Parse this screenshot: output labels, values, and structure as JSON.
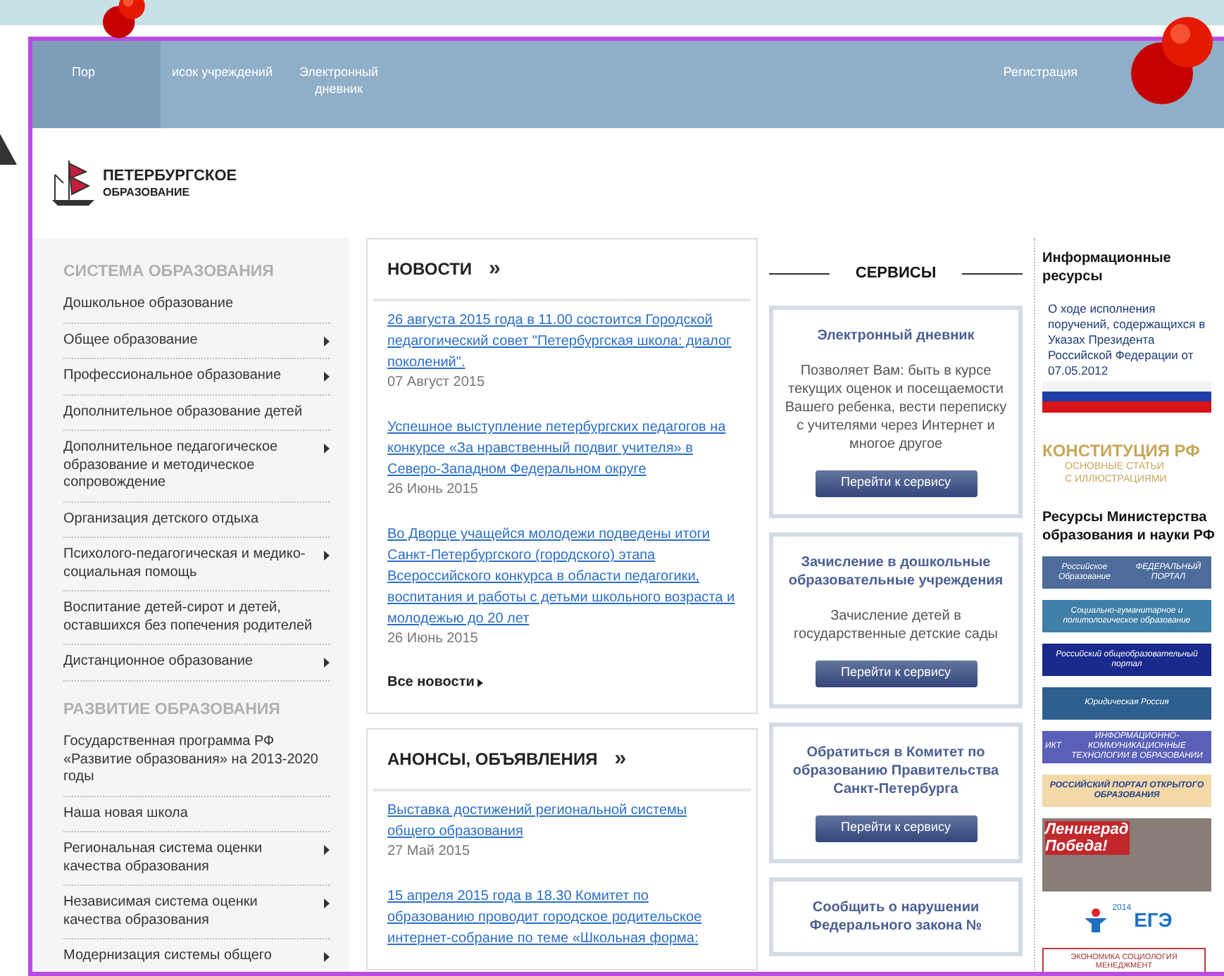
{
  "nav": {
    "items": [
      {
        "label": "Пор",
        "selected": true
      },
      {
        "label": "исок учреждений",
        "selected": false
      },
      {
        "label": "Электронный дневник",
        "selected": false
      }
    ],
    "register": "Регистрация"
  },
  "logo": {
    "line_1": "ПЕТЕРБУРГСКОЕ",
    "line_2": "ОБРАЗОВАНИЕ"
  },
  "sidebar": [
    {
      "title": "СИСТЕМА ОБРАЗОВАНИЯ",
      "items": [
        {
          "label": "Дошкольное образование",
          "has_submenu": false
        },
        {
          "label": "Общее образование",
          "has_submenu": true
        },
        {
          "label": "Профессиональное образование",
          "has_submenu": true
        },
        {
          "label": "Дополнительное образование детей",
          "has_submenu": false
        },
        {
          "label": "Дополнительное педагогическое образование и методическое сопровождение",
          "has_submenu": true
        },
        {
          "label": "Организация детского отдыха",
          "has_submenu": false
        },
        {
          "label": "Психолого-педагогическая и медико-социальная помощь",
          "has_submenu": true
        },
        {
          "label": "Воспитание детей-сирот и детей, оставшихся без попечения родителей",
          "has_submenu": false
        },
        {
          "label": "Дистанционное образование",
          "has_submenu": true
        }
      ]
    },
    {
      "title": "РАЗВИТИЕ ОБРАЗОВАНИЯ",
      "items": [
        {
          "label": "Государственная программа РФ «Развитие образования» на 2013-2020 годы",
          "has_submenu": false
        },
        {
          "label": "Наша новая школа",
          "has_submenu": false
        },
        {
          "label": "Региональная система оценки качества образования",
          "has_submenu": true
        },
        {
          "label": "Независимая система оценки качества образования",
          "has_submenu": true
        },
        {
          "label": "Модернизация системы общего",
          "has_submenu": true
        }
      ]
    }
  ],
  "news": [
    {
      "title": "НОВОСТИ",
      "arrow": "»",
      "items": [
        {
          "link": "26 августа 2015 года в 11.00 состоится Городской педагогический совет \"Петербургская школа: диалог поколений\".",
          "date": "07 Август 2015"
        },
        {
          "link": "Успешное выступление петербургских педагогов на конкурсе «За нравственный подвиг учителя» в Северо-Западном Федеральном округе",
          "date": "26 Июнь 2015"
        },
        {
          "link": "Во Дворце учащейся молодежи подведены итоги Санкт-Петербургского (городского) этапа Всероссийского конкурса в области педагогики, воспитания и работы с детьми школьного возраста и молодежью до 20 лет",
          "date": "26 Июнь 2015"
        }
      ],
      "more": "Все новости"
    },
    {
      "title": "АНОНСЫ, ОБЪЯВЛЕНИЯ",
      "arrow": "»",
      "items": [
        {
          "link": "Выставка достижений региональной системы общего образования",
          "date": "27 Май 2015"
        },
        {
          "link": "15 апреля 2015 года в 18.30 Комитет по образованию проводит городское родительское интернет-собрание по теме «Школьная форма:"
        }
      ]
    }
  ],
  "services": {
    "title": "СЕРВИСЫ",
    "cards": [
      {
        "title": "Электронный дневник",
        "description": "Позволяет Вам: быть в курсе текущих оценок и посещаемости Вашего ребенка, вести переписку с учителями через Интернет и многое другое",
        "button": "Перейти к сервису"
      },
      {
        "title": "Зачисление в дошкольные образовательные учреждения",
        "description": "Зачисление детей в государственные детские сады",
        "button": "Перейти к сервису"
      },
      {
        "title": "Обратиться в Комитет по образованию Правительства Санкт-Петербурга",
        "button": "Перейти к сервису"
      },
      {
        "title": "Сообщить о нарушении Федерального закона №"
      }
    ]
  },
  "resources": [
    {
      "title": "Информационные ресурсы",
      "banners": [
        {
          "kind": "flag",
          "texts": [
            "О ходе исполнения поручений, содержащихся в Указах Президента Российской Федерации от 07.05.2012"
          ]
        },
        {
          "kind": "gold",
          "texts": [
            "КОНСТИТУЦИЯ РФ",
            "ОСНОВНЫЕ СТАТЬИ С ИЛЛЮСТРАЦИЯМИ"
          ]
        }
      ]
    },
    {
      "title": "Ресурсы Министерства образования и науки РФ",
      "banners": [
        {
          "kind": "strip",
          "color": "#4d6c9c",
          "texts": [
            "Российское Образование",
            "ФЕДЕРАЛЬНЫЙ ПОРТАЛ"
          ]
        },
        {
          "kind": "strip",
          "color": "#3f7fa8",
          "texts": [
            "Социально-гуманитарное и политологическое образование"
          ]
        },
        {
          "kind": "strip",
          "color": "#1a2a8c",
          "texts": [
            "Российский общеобразовательный портал"
          ]
        },
        {
          "kind": "strip",
          "color": "#2d5f8f",
          "texts": [
            "Юридическая Россия"
          ]
        },
        {
          "kind": "strip",
          "color": "#5a5fb8",
          "texts": [
            "ИКТ",
            "ИНФОРМАЦИОННО-КОММУНИКАЦИОННЫЕ ТЕХНОЛОГИИ В ОБРАЗОВАНИИ"
          ]
        },
        {
          "kind": "light",
          "color": "#f3d9a8",
          "texts": [
            "РОССИЙСКИЙ ПОРТАЛ ОТКРЫТОГО ОБРАЗОВАНИЯ"
          ]
        },
        {
          "kind": "photo",
          "texts": [
            "Ленинград Победа!"
          ]
        },
        {
          "kind": "ege",
          "texts": [
            "2014",
            "ЕГЭ"
          ]
        },
        {
          "kind": "outline",
          "texts": [
            "ЭКОНОМИКА СОЦИОЛОГИЯ МЕНЕДЖМЕНТ"
          ]
        }
      ]
    }
  ]
}
